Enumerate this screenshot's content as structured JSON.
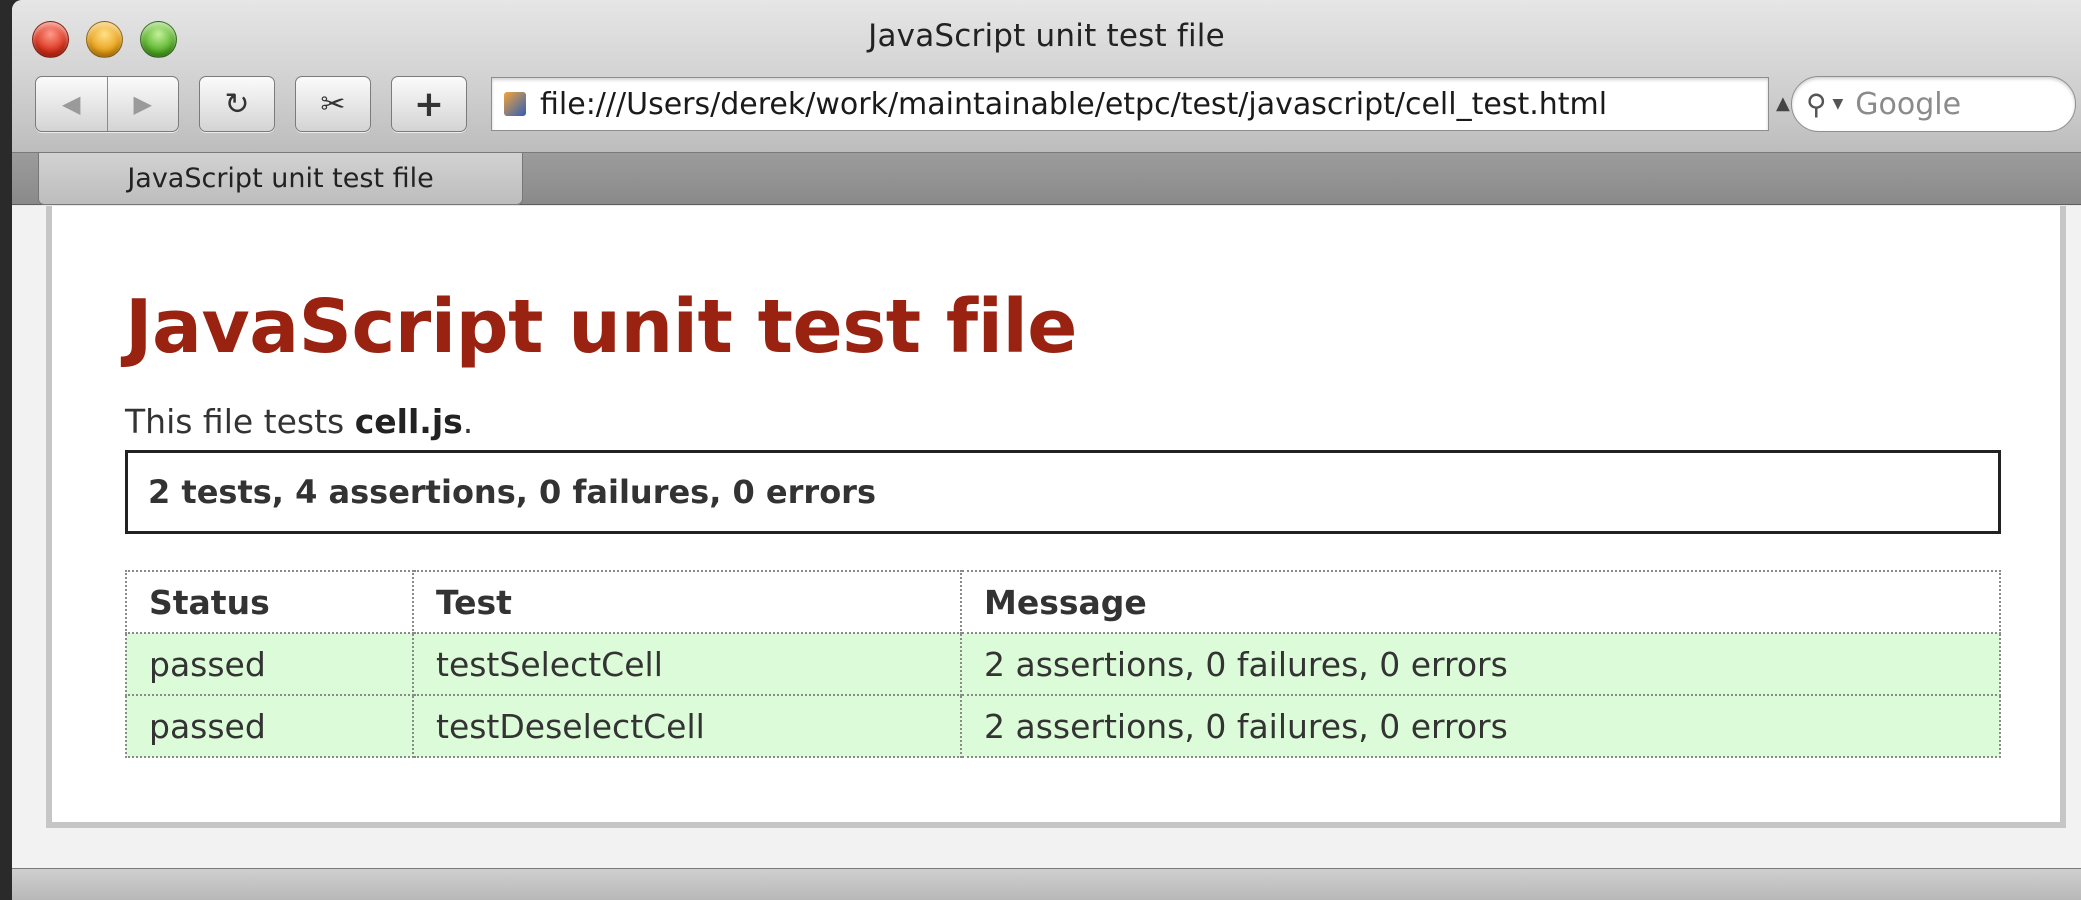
{
  "window": {
    "title": "JavaScript unit test file"
  },
  "toolbar": {
    "back_icon": "◀",
    "forward_icon": "▶",
    "reload_icon": "↻",
    "snip_icon": "✂",
    "add_label": "+",
    "url": "file:///Users/derek/work/maintainable/etpc/test/javascript/cell_test.html",
    "search_placeholder": "Google"
  },
  "tabs": [
    {
      "label": "JavaScript unit test file"
    }
  ],
  "page": {
    "title": "JavaScript unit test file",
    "intro_prefix": "This file tests ",
    "intro_file": "cell.js",
    "intro_suffix": ".",
    "summary": "2 tests, 4 assertions, 0 failures, 0 errors",
    "table": {
      "headers": [
        "Status",
        "Test",
        "Message"
      ],
      "rows": [
        [
          "passed",
          "testSelectCell",
          "2 assertions, 0 failures, 0 errors"
        ],
        [
          "passed",
          "testDeselectCell",
          "2 assertions, 0 failures, 0 errors"
        ]
      ]
    }
  },
  "colors": {
    "title": "#992211",
    "passed_row": "#dcfbd9"
  }
}
